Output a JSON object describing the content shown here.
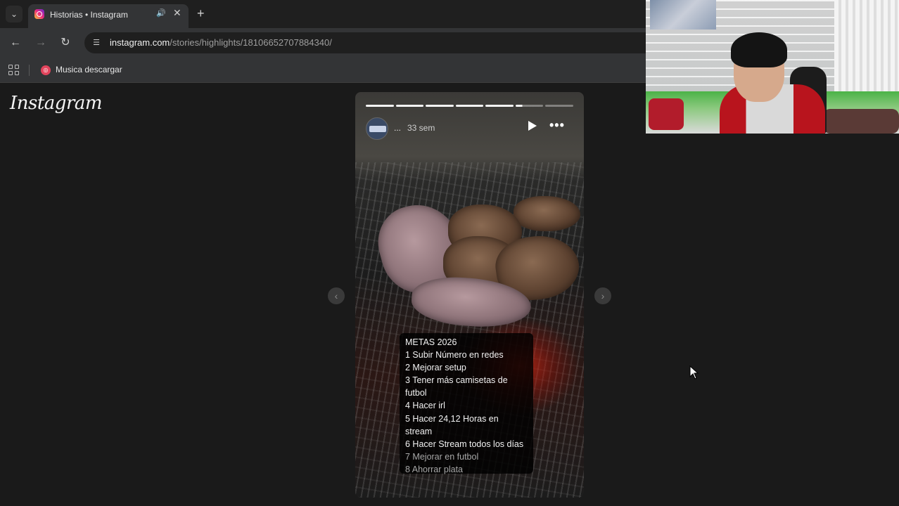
{
  "browser": {
    "tab": {
      "title": "Historias • Instagram",
      "audio_icon": "speaker-icon",
      "close_glyph": "✕"
    },
    "new_tab_glyph": "+",
    "toolbar": {
      "back_glyph": "←",
      "forward_glyph": "→",
      "reload_glyph": "↻",
      "url_host": "instagram.com",
      "url_path": "/stories/highlights/18106652707884340/"
    },
    "bookmarks": [
      {
        "label": "Musica descargar",
        "icon": "music-site-icon"
      }
    ]
  },
  "instagram": {
    "logo_text": "Instagram",
    "story": {
      "segments_total": 7,
      "segments_complete": 5,
      "current_segment_progress": 0.25,
      "username": "...",
      "time_ago": "33 sem",
      "goals": [
        "METAS 2026",
        "1 Subir Número en redes",
        "2 Mejorar setup",
        "3 Tener más camisetas de futbol",
        "4 Hacer irl",
        "5 Hacer 24,12 Horas en stream",
        "6 Hacer Stream todos los días",
        "7 Mejorar en futbol",
        "8 Ahorrar plata"
      ]
    },
    "prev_glyph": "‹",
    "next_glyph": "›"
  },
  "colors": {
    "page_bg": "#1a1a1a",
    "chrome_toolbar": "#333436",
    "chrome_tabstrip": "#1f1f1f",
    "instagram_gradient_start": "#f9ce34",
    "instagram_gradient_end": "#6228d7"
  }
}
